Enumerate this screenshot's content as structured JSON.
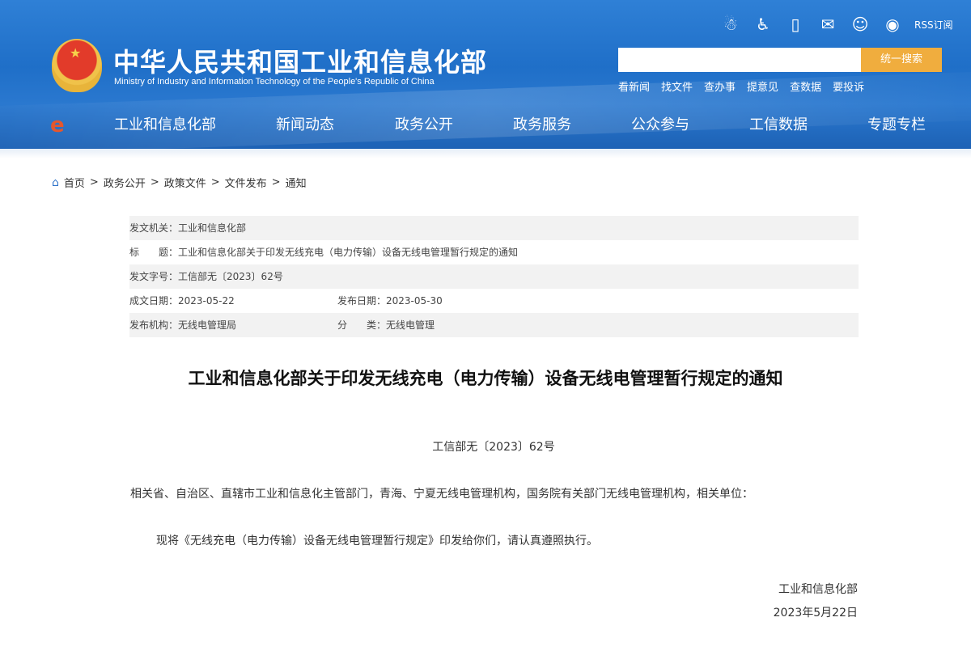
{
  "header": {
    "title_cn": "中华人民共和国工业和信息化部",
    "title_en": "Ministry of Industry and Information Technology of the People's Republic of China",
    "rss": "RSS订阅",
    "search_button": "统一搜索",
    "search_placeholder": "",
    "quick_links": [
      "看新闻",
      "找文件",
      "查办事",
      "提意见",
      "查数据",
      "要投诉"
    ]
  },
  "nav": [
    "工业和信息化部",
    "新闻动态",
    "政务公开",
    "政务服务",
    "公众参与",
    "工信数据",
    "专题专栏"
  ],
  "breadcrumb": [
    "首页",
    "政务公开",
    "政策文件",
    "文件发布",
    "通知"
  ],
  "meta": {
    "issuer_label": "发文机关：",
    "issuer": "工业和信息化部",
    "title_label": "标　　题：",
    "title": "工业和信息化部关于印发无线充电（电力传输）设备无线电管理暂行规定的通知",
    "docno_label": "发文字号：",
    "docno": "工信部无〔2023〕62号",
    "written_label": "成文日期：",
    "written": "2023-05-22",
    "published_label": "发布日期：",
    "published": "2023-05-30",
    "agency_label": "发布机构：",
    "agency": "无线电管理局",
    "category_label": "分　　类：",
    "category": "无线电管理"
  },
  "doc": {
    "title": "工业和信息化部关于印发无线充电（电力传输）设备无线电管理暂行规定的通知",
    "docno": "工信部无〔2023〕62号",
    "p1": "相关省、自治区、直辖市工业和信息化主管部门，青海、宁夏无线电管理机构，国务院有关部门无线电管理机构，相关单位：",
    "p2": "现将《无线充电（电力传输）设备无线电管理暂行规定》印发给你们，请认真遵照执行。",
    "sign_org": "工业和信息化部",
    "sign_date": "2023年5月22日"
  }
}
